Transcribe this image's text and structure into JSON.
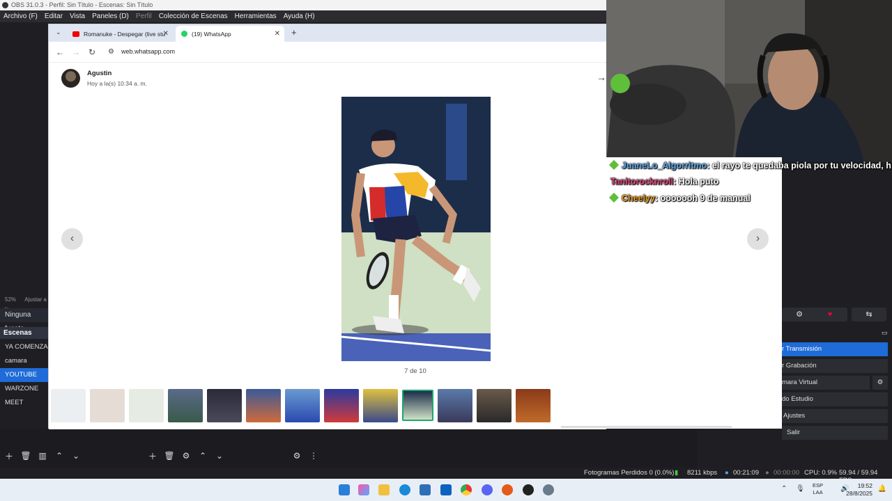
{
  "obs": {
    "title": "OBS 31.0.3 - Perfil: Sin Título - Escenas: Sin Título",
    "menu": [
      "Archivo (F)",
      "Editar",
      "Vista",
      "Paneles (D)",
      "Perfil",
      "Colección de Escenas",
      "Herramientas",
      "Ayuda (H)"
    ],
    "zoom": "52%",
    "zoom_option": "Ajustar a la",
    "source_placeholder": "Ninguna fuente",
    "scenes_header": "Escenas",
    "scenes": [
      "YA COMENZAM",
      "camara",
      "YOUTUBE",
      "WARZONE",
      "MEET"
    ],
    "controls": [
      "r Transmisión",
      "r Grabación",
      "mara Virtual",
      "do Estudio",
      "Ajustes",
      "Salir"
    ],
    "status": {
      "dropped": "Fotogramas Perdidos 0 (0.0%)",
      "bitrate": "8211 kbps",
      "stream_time": "00:21:09",
      "rec_time": "00:00:00",
      "cpu": "CPU: 0.9%",
      "fps": "59.94 / 59.94 FPS"
    }
  },
  "browser": {
    "tabs": [
      {
        "label": "Romanuke - Despegar (live stu",
        "icon": "youtube-icon"
      },
      {
        "label": "(19) WhatsApp",
        "icon": "whatsapp-icon"
      }
    ],
    "new_tab": "+",
    "url": "web.whatsapp.com"
  },
  "viewer": {
    "sender": "Agustin",
    "time": "Hoy a la(s) 10:34 a. m.",
    "counter": "7 de 10",
    "current_index": 7,
    "total": 10
  },
  "chat": [
    {
      "user": "JuaneLo_Algorritmo",
      "user_color": "#5fa8e6",
      "text": ": el rayo te quedaba piola por tu velocidad, h"
    },
    {
      "user": "Tanitorocknroll",
      "user_color": "#e0457b",
      "text": ": Hola puto"
    },
    {
      "user": "Cheelyy",
      "user_color": "#e8a020",
      "text": ": ooooooh 9 de manual"
    }
  ],
  "taskbar": {
    "lang_top": "ESP",
    "lang_bottom": "LAA",
    "time": "19:52",
    "date": "28/8/2025"
  },
  "colors": {
    "accent": "#1f6bd8",
    "whatsapp_green": "#18a86f"
  }
}
